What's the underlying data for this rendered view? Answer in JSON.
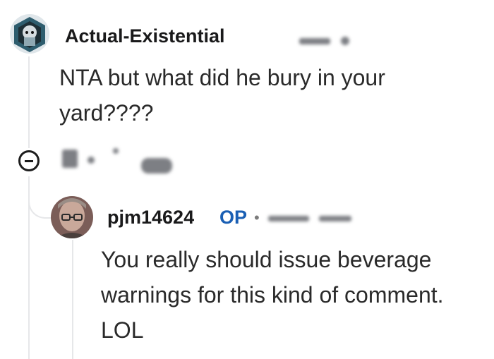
{
  "comment": {
    "author": "Actual-Existential",
    "text_line1": "NTA but what did he bury in your",
    "text_line2": "yard????"
  },
  "reply": {
    "author": "pjm14624",
    "op_badge": "OP",
    "separator": "•",
    "text_line1": "You really should issue beverage",
    "text_line2": "warnings for this kind of comment.",
    "text_line3": "LOL"
  },
  "icons": {
    "collapse": "collapse-minus-icon",
    "avatar1": "snoo-avatar-icon",
    "avatar2": "user-photo-avatar"
  },
  "colors": {
    "op_badge": "#1a5fb4",
    "thread_line": "#e6e7e9",
    "text": "#2a2a2a"
  }
}
